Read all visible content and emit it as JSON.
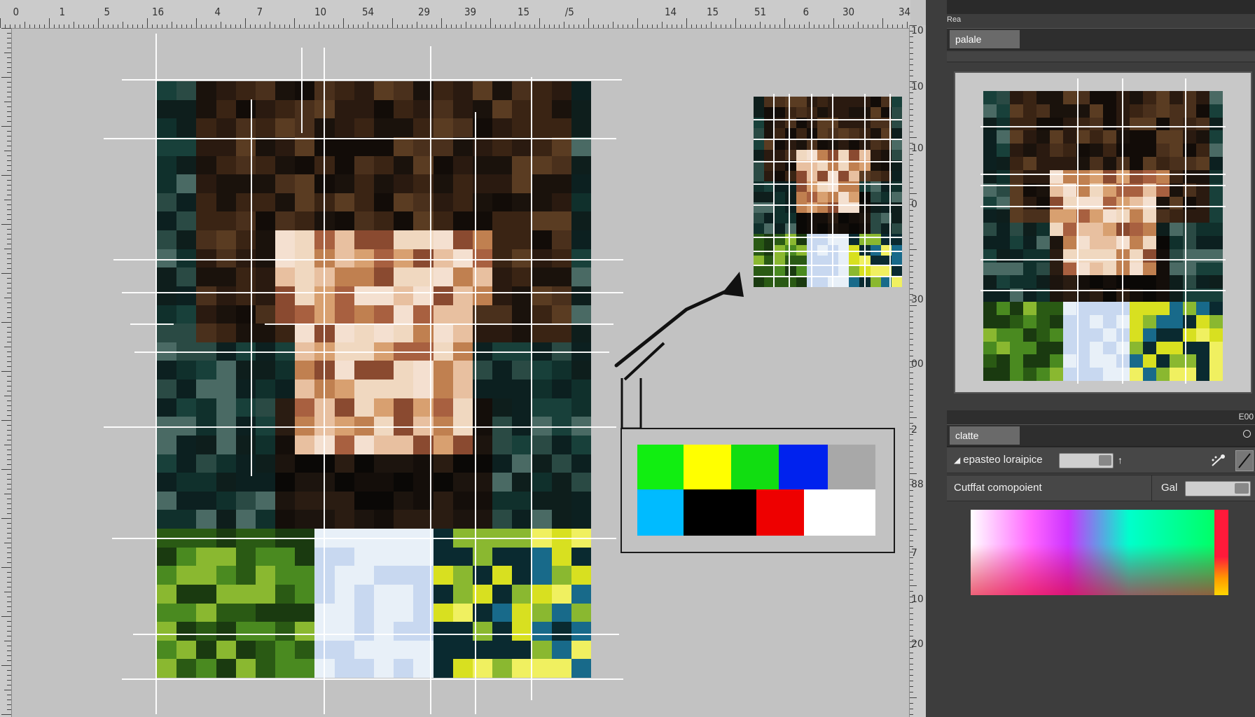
{
  "ruler_top": [
    "0",
    "1",
    "5",
    "16",
    "4",
    "7",
    "10",
    "54",
    "29",
    "39",
    "15",
    "/5",
    "14",
    "15",
    "51",
    "6",
    "30",
    "34"
  ],
  "ruler_right": [
    "10",
    "10",
    "10",
    "0",
    "30",
    "00",
    "2",
    "88",
    "7",
    "10",
    "20"
  ],
  "panel": {
    "title": "Rea",
    "tab1_label": "palale",
    "tab2_label": "clatte",
    "scroll_right_label": "E00",
    "row1_label": "epasteo loraipice",
    "row1_arrow": "↑",
    "row2_label": "Cutffat comopoient",
    "row2_field_label": "Gal"
  },
  "swatches": {
    "top": [
      "#11ee11",
      "#ffff00",
      "#11dd11",
      "#0022ee",
      "#a8a8a8"
    ],
    "bottom": [
      "#00bbff",
      "#000000",
      "#ee0000",
      "#ffffff"
    ]
  },
  "icons": [
    "arrow-up-right-icon",
    "collapse-icon",
    "eyedropper-icon",
    "brush-icon",
    "slider-icon"
  ]
}
